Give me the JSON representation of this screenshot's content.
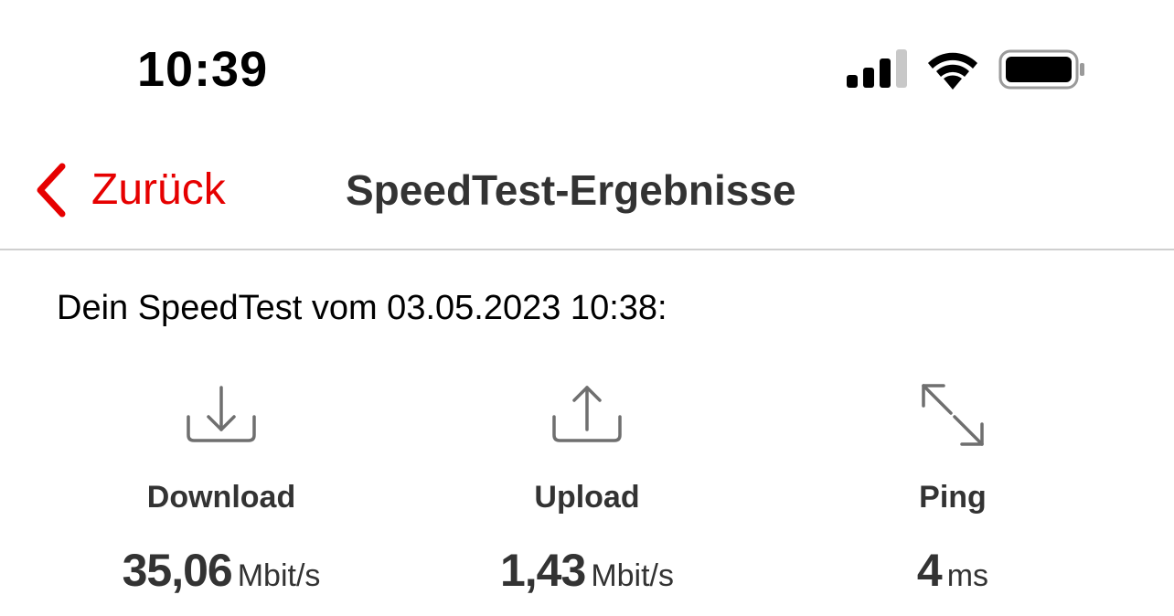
{
  "status_bar": {
    "time": "10:39",
    "icons": [
      "cellular-signal-icon",
      "wifi-icon",
      "battery-icon"
    ]
  },
  "nav": {
    "back_label": "Zurück",
    "title": "SpeedTest-Ergebnisse",
    "accent_color": "#e60000"
  },
  "content": {
    "subtitle": "Dein SpeedTest vom 03.05.2023 10:38:",
    "metrics": [
      {
        "label": "Download",
        "value": "35,06",
        "unit": "Mbit/s",
        "icon": "download-icon"
      },
      {
        "label": "Upload",
        "value": "1,43",
        "unit": "Mbit/s",
        "icon": "upload-icon"
      },
      {
        "label": "Ping",
        "value": "4",
        "unit": "ms",
        "icon": "ping-arrows-icon"
      }
    ]
  }
}
